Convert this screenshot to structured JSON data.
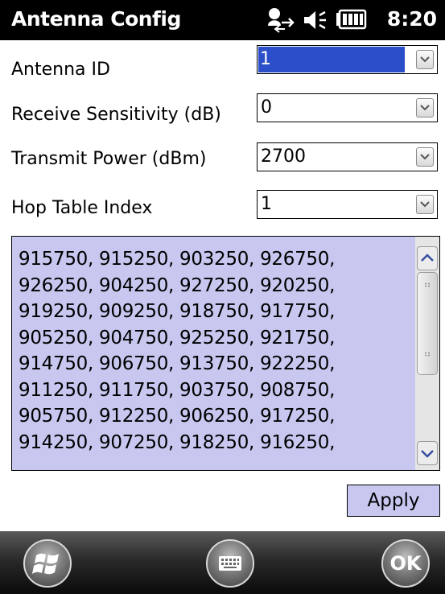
{
  "titlebar": {
    "title": "Antenna Config",
    "time": "8:20",
    "icons": [
      "connectivity-icon",
      "speaker-icon",
      "battery-icon"
    ]
  },
  "form": {
    "antenna_id": {
      "label": "Antenna ID",
      "value": "1",
      "selected": true
    },
    "receive_sensitivity": {
      "label": "Receive Sensitivity (dB)",
      "value": "0"
    },
    "transmit_power": {
      "label": "Transmit Power (dBm)",
      "value": "2700"
    },
    "hop_table_index": {
      "label": "Hop Table Index",
      "value": "1"
    }
  },
  "frequency_list": {
    "lines": [
      "915750, 915250, 903250, 926750,",
      "926250, 904250, 927250, 920250,",
      "919250, 909250, 918750, 917750,",
      "905250, 904750, 925250, 921750,",
      "914750, 906750, 913750, 922250,",
      "911250, 911750, 903750, 908750,",
      "905750, 912250, 906250, 917250,",
      "914250, 907250, 918250, 916250,"
    ]
  },
  "actions": {
    "apply_label": "Apply"
  },
  "softkeys": {
    "start_icon": "windows-start-icon",
    "keyboard_icon": "keyboard-icon",
    "ok_label": "OK"
  },
  "colors": {
    "titlebar_bg": "#000000",
    "selection": "#2a4fc9",
    "list_bg": "#c7c7f0"
  }
}
